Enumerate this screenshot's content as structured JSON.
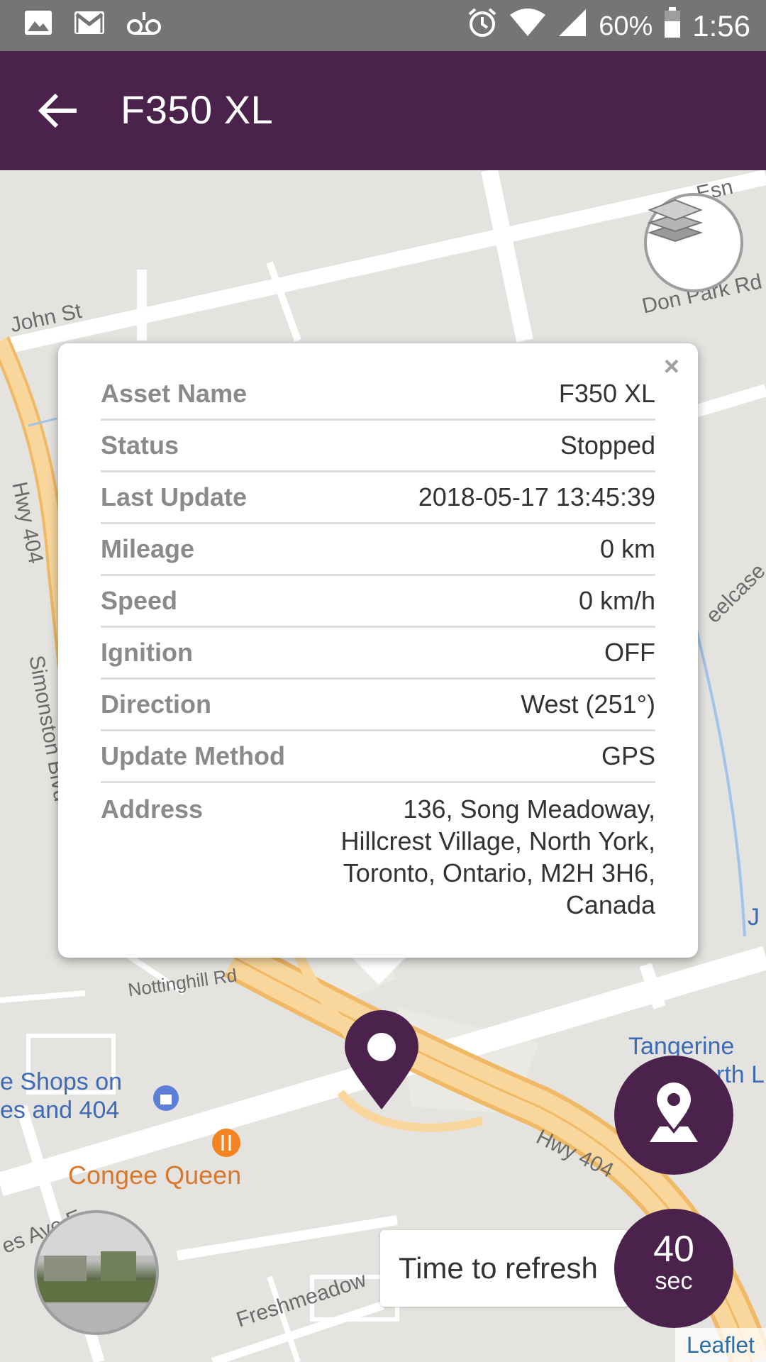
{
  "status_bar": {
    "battery": "60%",
    "time": "1:56",
    "left_icons": [
      "image-icon",
      "gmail-icon",
      "voicemail-icon"
    ],
    "right_icons": [
      "alarm-icon",
      "wifi-icon",
      "signal-icon",
      "battery-icon"
    ]
  },
  "app_bar": {
    "title": "F350 XL",
    "back_icon": "arrow-left-icon",
    "background": "#4a224c"
  },
  "map": {
    "labels": {
      "john_st": "John St",
      "don_park": "Don Park Rd",
      "esna": "Esn",
      "hwy404_left": "Hwy 404",
      "simonston": "Simonston Blvd",
      "steelcase": "eelcase",
      "nottinghill": "Nottinghill Rd",
      "shops_1": "e Shops on",
      "shops_2": "es and 404",
      "congee": "Congee Queen",
      "tangerine_1": "Tangerine",
      "tangerine_2": "rth L",
      "hwy404_right": "Hwy 404",
      "freshmeadow": "Freshmeadow",
      "es_ave": "es Ave E",
      "j_label": "J"
    },
    "attribution": "Leaflet"
  },
  "popup": {
    "close": "×",
    "rows": [
      {
        "label": "Asset Name",
        "value": "F350 XL"
      },
      {
        "label": "Status",
        "value": "Stopped"
      },
      {
        "label": "Last Update",
        "value": "2018-05-17 13:45:39"
      },
      {
        "label": "Mileage",
        "value": "0 km"
      },
      {
        "label": "Speed",
        "value": "0 km/h"
      },
      {
        "label": "Ignition",
        "value": "OFF"
      },
      {
        "label": "Direction",
        "value": "West (251°)"
      },
      {
        "label": "Update Method",
        "value": "GPS"
      }
    ],
    "address": {
      "label": "Address",
      "lines": [
        "136, Song Meadoway,",
        "Hillcrest Village, North York,",
        "Toronto, Ontario, M2H 3H6,",
        "Canada"
      ]
    }
  },
  "refresh": {
    "label": "Time to refresh",
    "seconds": "40",
    "unit": "sec"
  },
  "colors": {
    "accent": "#4a224c",
    "map_bg": "#e5e3df",
    "highway": "#f9cf8a"
  }
}
